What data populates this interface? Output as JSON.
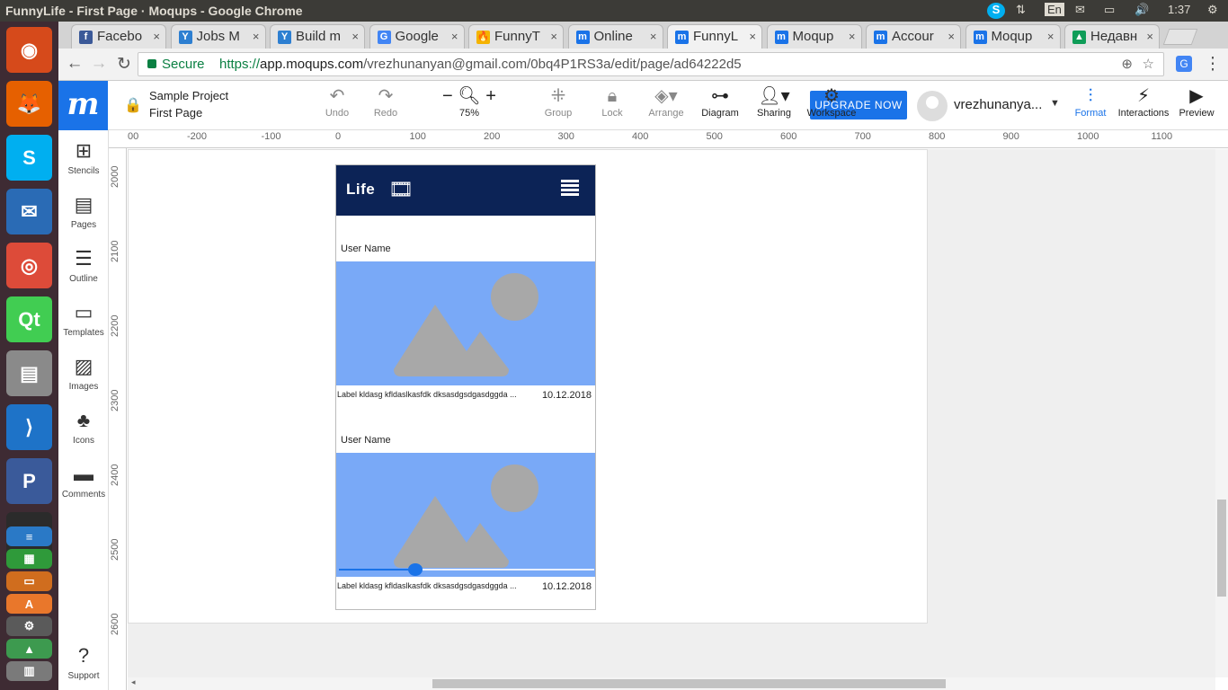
{
  "os": {
    "window_title": "FunnyLife - First Page · Moqups - Google Chrome",
    "keyboard": "En",
    "time": "1:37"
  },
  "launcher": [
    {
      "name": "ubuntu-dash-icon",
      "glyph": "◉",
      "color": "#d64a1b"
    },
    {
      "name": "firefox-icon",
      "glyph": "🦊",
      "color": "#e66000"
    },
    {
      "name": "skype-preview-icon",
      "glyph": "S",
      "color": "#00aff0"
    },
    {
      "name": "thunderbird-icon",
      "glyph": "✉",
      "color": "#2a6bb5"
    },
    {
      "name": "chrome-icon",
      "glyph": "◎",
      "color": "#dd4b39"
    },
    {
      "name": "qt-creator-icon",
      "glyph": "Qt",
      "color": "#41cd52"
    },
    {
      "name": "file-manager-icon",
      "glyph": "▤",
      "color": "#8a8a8a"
    },
    {
      "name": "vscode-icon",
      "glyph": "⟩",
      "color": "#1e73c8"
    },
    {
      "name": "phpstorm-icon",
      "glyph": "P",
      "color": "#3a5a9a"
    },
    {
      "name": "terminal-icon",
      "glyph": ">_",
      "color": "#2b2b2b"
    },
    {
      "name": "libreoffice-writer-icon",
      "glyph": "≡",
      "color": "#2a79c6"
    },
    {
      "name": "libreoffice-calc-icon",
      "glyph": "▦",
      "color": "#2f9a3a"
    },
    {
      "name": "libreoffice-impress-icon",
      "glyph": "▭",
      "color": "#d06d1e"
    },
    {
      "name": "software-center-icon",
      "glyph": "A",
      "color": "#e9772b"
    },
    {
      "name": "settings-icon",
      "glyph": "⚙",
      "color": "#5a5a5a"
    },
    {
      "name": "android-studio-icon",
      "glyph": "▲",
      "color": "#3d9a4f"
    },
    {
      "name": "trash-icon",
      "glyph": "▥",
      "color": "#7a7a7a"
    }
  ],
  "tabs": [
    {
      "label": "Facebo",
      "icon": "f",
      "color": "#3b5998",
      "active": false
    },
    {
      "label": "Jobs M",
      "icon": "Y",
      "color": "#2d7fd1",
      "active": false
    },
    {
      "label": "Build m",
      "icon": "Y",
      "color": "#2d7fd1",
      "active": false
    },
    {
      "label": "Google",
      "icon": "G",
      "color": "#4285f4",
      "active": false
    },
    {
      "label": "FunnyT",
      "icon": "🔥",
      "color": "#f4b400",
      "active": false
    },
    {
      "label": "Online",
      "icon": "m",
      "color": "#1a73e8",
      "active": false
    },
    {
      "label": "FunnyL",
      "icon": "m",
      "color": "#1a73e8",
      "active": true
    },
    {
      "label": "Moqup",
      "icon": "m",
      "color": "#1a73e8",
      "active": false
    },
    {
      "label": "Accour",
      "icon": "m",
      "color": "#1a73e8",
      "active": false
    },
    {
      "label": "Moqup",
      "icon": "m",
      "color": "#1a73e8",
      "active": false
    },
    {
      "label": "Недавн",
      "icon": "▲",
      "color": "#0f9d58",
      "active": false
    }
  ],
  "address": {
    "secure_label": "Secure",
    "url_scheme": "https://",
    "url_host": "app.moqups.com",
    "url_path": "/vrezhunanyan@gmail.com/0bq4P1RS3a/edit/page/ad64222d5"
  },
  "project": {
    "name": "Sample Project",
    "page": "First Page"
  },
  "toolbar": {
    "undo": "Undo",
    "redo": "Redo",
    "zoom": "75%",
    "zoom_minus": "−",
    "zoom_plus": "+",
    "group": "Group",
    "lock": "Lock",
    "arrange": "Arrange",
    "diagram": "Diagram",
    "sharing": "Sharing",
    "workspace": "Workspace",
    "upgrade": "UPGRADE NOW",
    "user": "vrezhunanya...",
    "format": "Format",
    "interactions": "Interactions",
    "preview": "Preview"
  },
  "left_panel": [
    {
      "label": "Stencils",
      "icon": "stencils-icon",
      "glyph": "⊞"
    },
    {
      "label": "Pages",
      "icon": "pages-icon",
      "glyph": "▤"
    },
    {
      "label": "Outline",
      "icon": "outline-icon",
      "glyph": "☰"
    },
    {
      "label": "Templates",
      "icon": "templates-icon",
      "glyph": "▭"
    },
    {
      "label": "Images",
      "icon": "images-icon",
      "glyph": "▨"
    },
    {
      "label": "Icons",
      "icon": "icons-icon",
      "glyph": "♣"
    },
    {
      "label": "Comments",
      "icon": "comments-icon",
      "glyph": "▬"
    },
    {
      "label": "Support",
      "icon": "support-icon",
      "glyph": "?"
    }
  ],
  "ruler": {
    "horizontal": [
      "00",
      "-200",
      "-100",
      "0",
      "100",
      "200",
      "300",
      "400",
      "500",
      "600",
      "700",
      "800",
      "900",
      "1000",
      "1100"
    ],
    "vertical": [
      "2000",
      "2100",
      "2200",
      "2300",
      "2400",
      "2500",
      "2600"
    ]
  },
  "mockup": {
    "brand": "Life",
    "posts": [
      {
        "user": "User Name",
        "label": "Label kldasg kfldaslkasfdk dksasdgsdgasdggda ...",
        "date": "10.12.2018",
        "slider": false
      },
      {
        "user": "User Name",
        "label": "Label kldasg kfldaslkasfdk dksasdgsdgasdggda ...",
        "date": "10.12.2018",
        "slider": true,
        "slider_value": 0.3
      }
    ]
  }
}
